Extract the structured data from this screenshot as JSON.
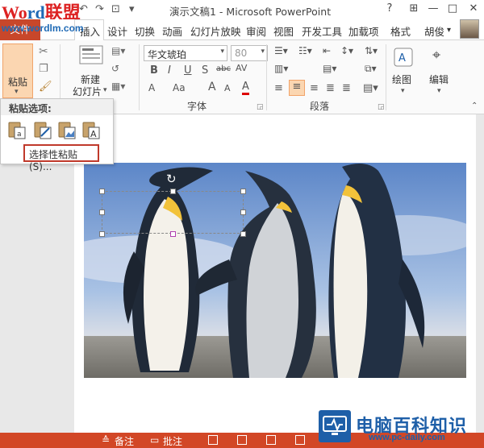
{
  "title_bar": {
    "watermark_part1": "Wo",
    "watermark_part2": "rd",
    "watermark_part3": "联盟",
    "window_title": "演示文稿1 - Microsoft PowerPoint",
    "help": "?",
    "minimize": "—",
    "restore": "□",
    "close": "✕"
  },
  "watermark_url": "www.wordlm.com",
  "tabs": {
    "file": "文件",
    "home": "开始",
    "insert": "插入",
    "design": "设计",
    "transitions": "切换",
    "animations": "动画",
    "slideshow": "幻灯片放映",
    "review": "审阅",
    "view": "视图",
    "developer": "开发工具",
    "addins": "加载项",
    "format": "格式",
    "user": "胡俊"
  },
  "ribbon": {
    "paste_label": "粘贴",
    "new_slide_line1": "新建",
    "new_slide_line2": "幻灯片",
    "font_name": "华文琥珀",
    "font_size": "80",
    "bold": "B",
    "italic": "I",
    "underline": "U",
    "strike": "S",
    "shadow": "abc",
    "char_spacing": "AV",
    "change_case": "Aa",
    "grow_font": "A",
    "shrink_font": "A",
    "clear_format": "A",
    "font_color": "A",
    "font_group": "字体",
    "paragraph_group": "段落",
    "drawing_label": "绘图",
    "editing_label": "编辑"
  },
  "paste_menu": {
    "header": "粘贴选项:",
    "paste_special": "选择性粘贴(S)..."
  },
  "status_bar": {
    "notes": "备注",
    "comments": "批注"
  },
  "brand": {
    "name": "电脑百科知识",
    "url": "www.pc-daily.com"
  },
  "colors": {
    "accent": "#d24726",
    "file_tab": "#c8472a",
    "paste_special_border": "#c0392b",
    "brand_blue": "#1e5fa8"
  }
}
